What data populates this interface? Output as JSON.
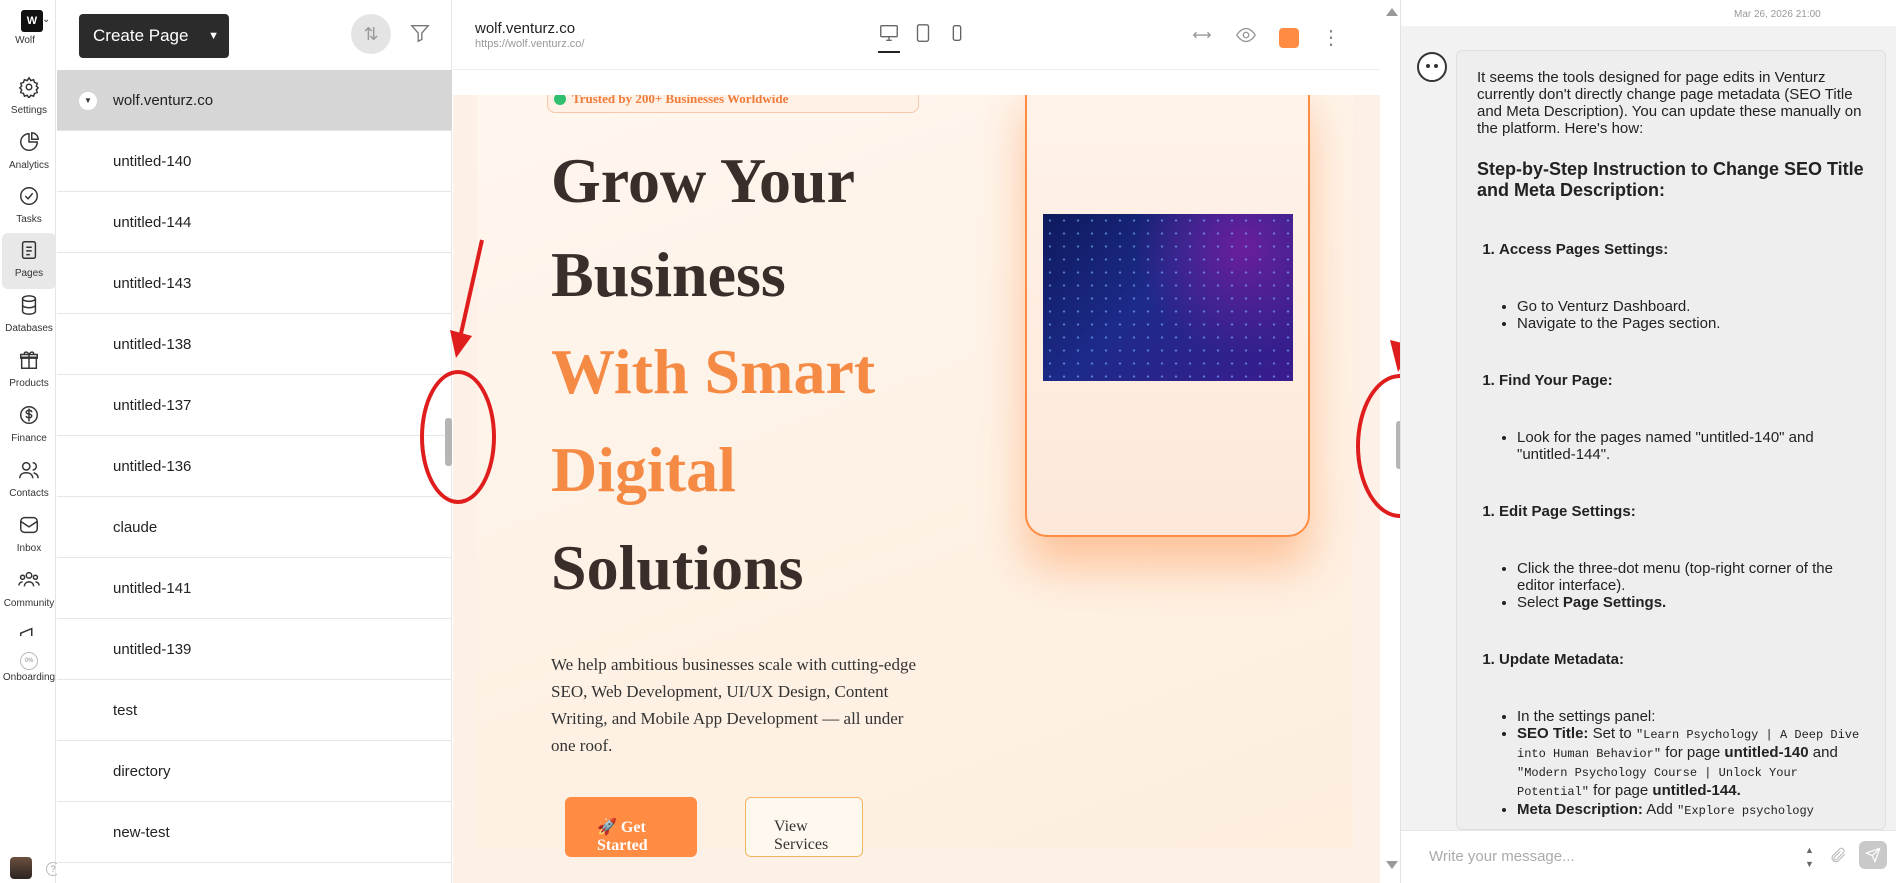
{
  "workspace": {
    "logo_letter": "W",
    "name": "Wolf"
  },
  "rail": {
    "settings": "Settings",
    "analytics": "Analytics",
    "tasks": "Tasks",
    "pages": "Pages",
    "databases": "Databases",
    "products": "Products",
    "finance": "Finance",
    "contacts": "Contacts",
    "inbox": "Inbox",
    "community": "Community",
    "onboarding": "Onboarding",
    "onboarding_percent": "0%",
    "help": "?"
  },
  "pages_panel": {
    "create_label": "Create Page",
    "root": "wolf.venturz.co",
    "items": [
      "untitled-140",
      "untitled-144",
      "untitled-143",
      "untitled-138",
      "untitled-137",
      "untitled-136",
      "claude",
      "untitled-141",
      "untitled-139",
      "test",
      "directory",
      "new-test"
    ]
  },
  "preview": {
    "site_name": "wolf.venturz.co",
    "site_url": "https://wolf.venturz.co/",
    "accent_color": "#ff8c42",
    "hero": {
      "trusted": "Trusted by 200+ Businesses Worldwide",
      "line1": "Grow Your",
      "line2": "Business",
      "line3": "With Smart",
      "line4": "Digital",
      "line5": "Solutions",
      "desc": "We help ambitious businesses scale with cutting-edge SEO, Web Development, UI/UX Design, Content Writing, and Mobile App Development — all under one roof.",
      "cta_primary": "🚀 Get Started",
      "cta_secondary": "View Services"
    }
  },
  "chat": {
    "timestamp": "Mar 26, 2026 21:00",
    "intro": "It seems the tools designed for page edits in Venturz currently don't directly change page metadata (SEO Title and Meta Description). You can update these manually on the platform. Here's how:",
    "heading": "Step-by-Step Instruction to Change SEO Title and Meta Description:",
    "step1": "Access Pages Settings:",
    "step1_a": "Go to Venturz Dashboard.",
    "step1_b": "Navigate to the Pages section.",
    "step2": "Find Your Page:",
    "step2_a": "Look for the pages named \"untitled-140\" and \"untitled-144\".",
    "step3": "Edit Page Settings:",
    "step3_a": "Click the three-dot menu (top-right corner of the editor interface).",
    "step3_b_pre": "Select ",
    "step3_b_bold": "Page Settings.",
    "step4": "Update Metadata:",
    "step4_a": "In the settings panel:",
    "seo_label": "SEO Title:",
    "seo_set_to": " Set to ",
    "seo_val1": "\"Learn Psychology | A Deep Dive into Human Behavior\"",
    "seo_for": " for page ",
    "seo_page1": "untitled-140",
    "seo_and": " and ",
    "seo_val2": "\"Modern Psychology Course | Unlock Your Potential\"",
    "seo_for2": " for page ",
    "seo_page2": "untitled-144.",
    "meta_label": "Meta Description:",
    "meta_add": " Add ",
    "meta_val": "\"Explore psychology",
    "composer_placeholder": "Write your message..."
  },
  "colors": {
    "annotation_red": "#e01d1d",
    "accent": "#ff8c42"
  }
}
